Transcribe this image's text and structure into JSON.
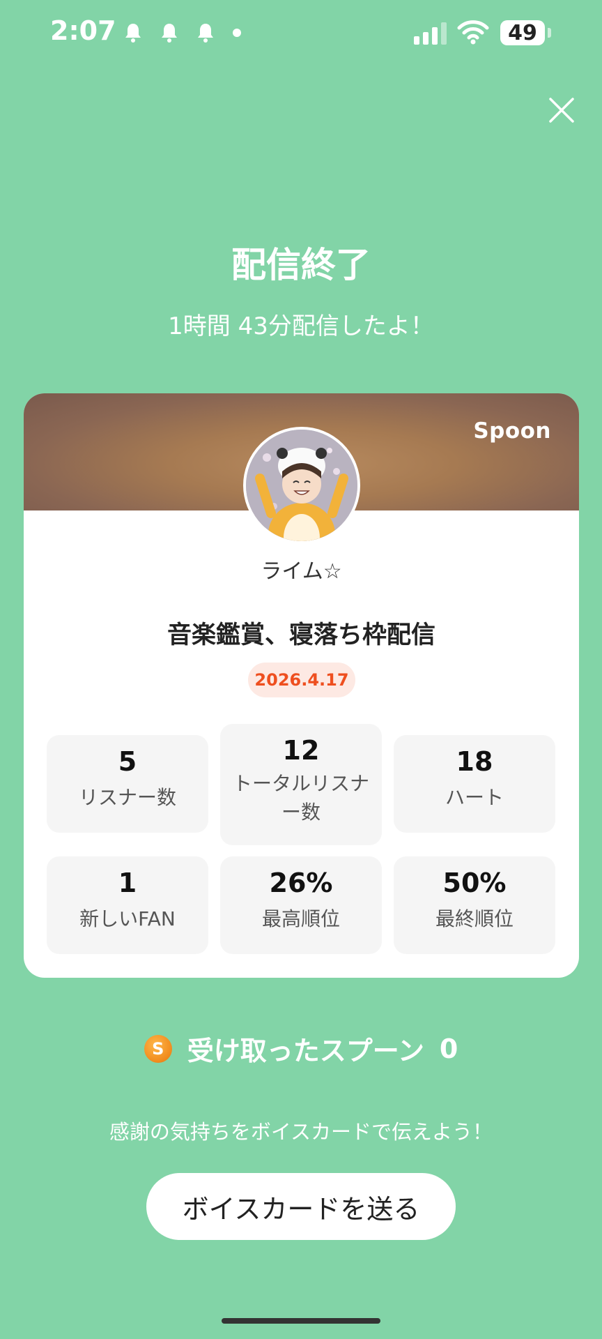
{
  "status_bar": {
    "time": "2:07",
    "battery": "49"
  },
  "header": {
    "title": "配信終了",
    "subtitle": "1時間 43分配信したよ！"
  },
  "card": {
    "brand": "Spoon",
    "nickname": "ライム☆",
    "stream_title": "音楽鑑賞、寝落ち枠配信",
    "date": "2026.4.17",
    "stats": [
      {
        "value": "5",
        "label": "リスナー数"
      },
      {
        "value": "12",
        "label": "トータルリスナー数"
      },
      {
        "value": "18",
        "label": "ハート"
      },
      {
        "value": "1",
        "label": "新しいFAN"
      },
      {
        "value": "26%",
        "label": "最高順位"
      },
      {
        "value": "50%",
        "label": "最終順位"
      }
    ]
  },
  "spoons": {
    "coin_symbol": "S",
    "label": "受け取ったスプーン",
    "count": "0"
  },
  "footer": {
    "message": "感謝の気持ちをボイスカードで伝えよう！",
    "button_label": "ボイスカードを送る"
  },
  "colors": {
    "background": "#82d4a7",
    "date_accent": "#ee4f1f",
    "coin": "#f08a1c"
  }
}
